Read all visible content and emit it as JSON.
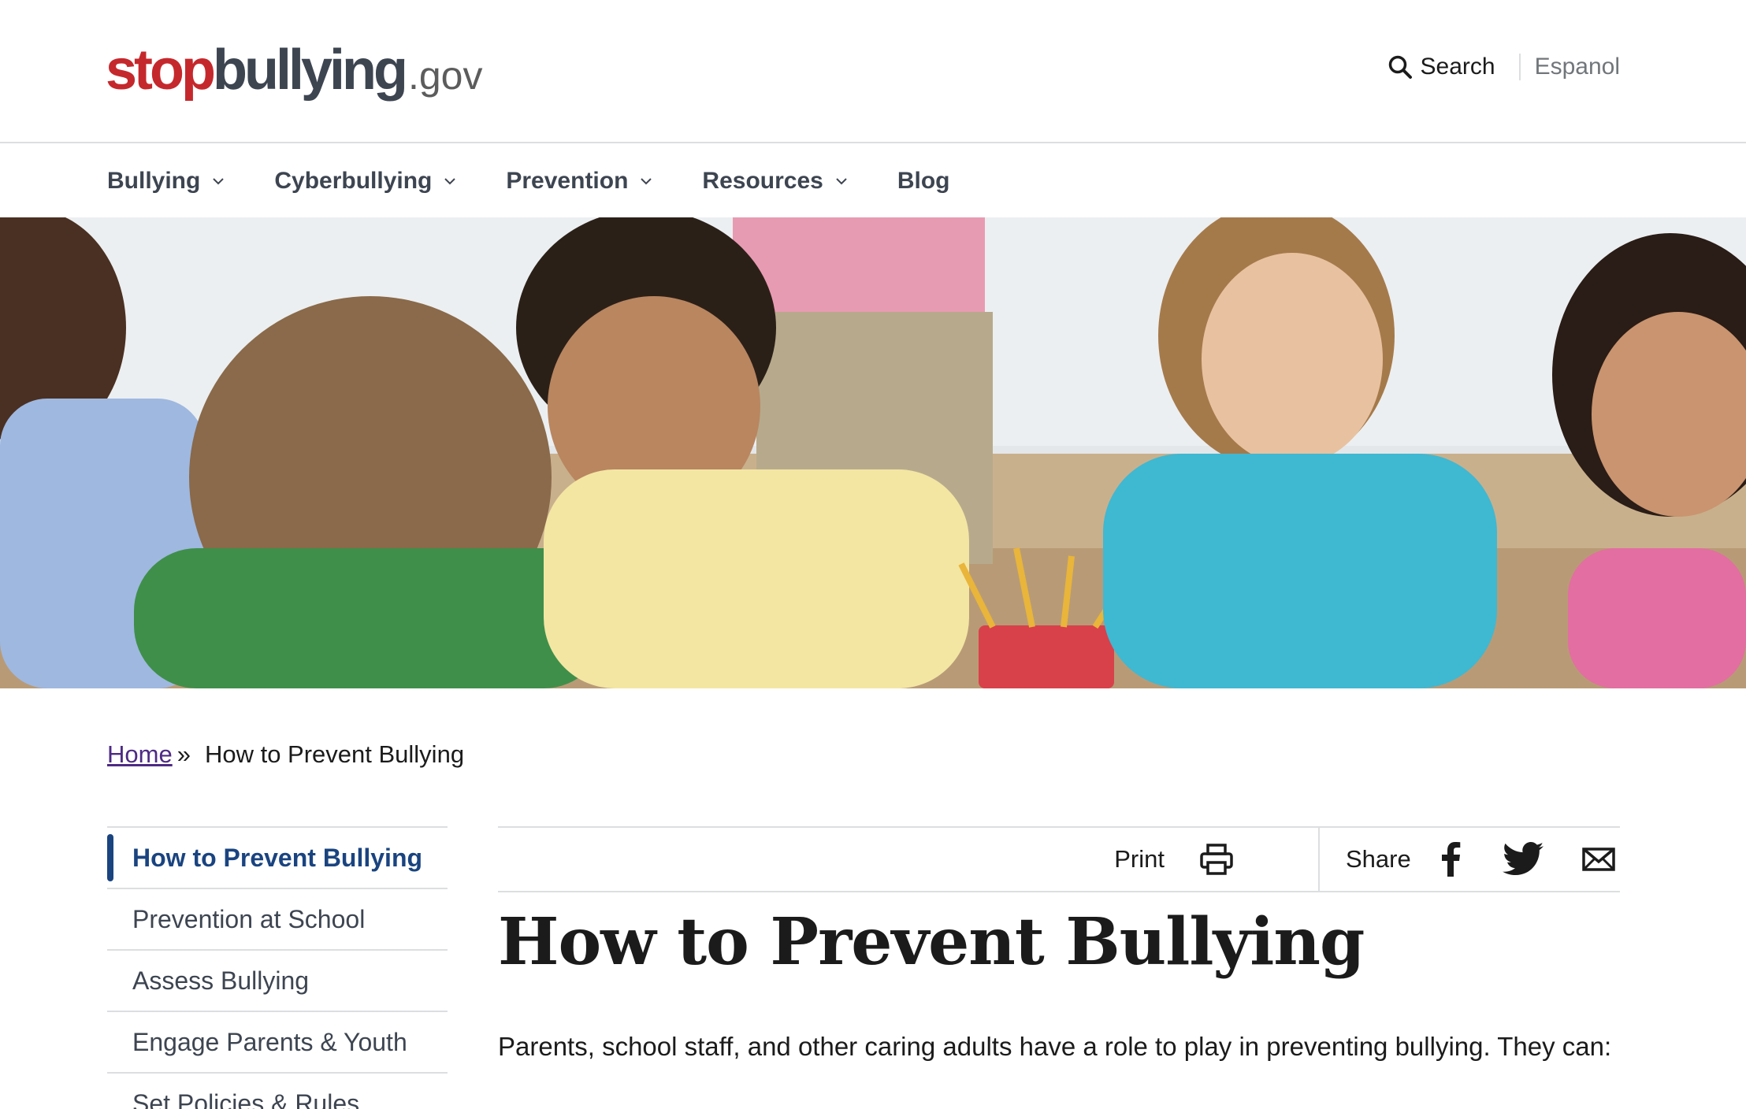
{
  "header": {
    "logo": {
      "stop": "stop",
      "bullying": "bullying",
      "gov": ".gov"
    },
    "search_label": "Search",
    "language_link": "Espanol"
  },
  "nav": {
    "items": [
      {
        "label": "Bullying",
        "has_dropdown": true
      },
      {
        "label": "Cyberbullying",
        "has_dropdown": true
      },
      {
        "label": "Prevention",
        "has_dropdown": true
      },
      {
        "label": "Resources",
        "has_dropdown": true
      },
      {
        "label": "Blog",
        "has_dropdown": false
      }
    ]
  },
  "breadcrumb": {
    "home": "Home",
    "separator": "»",
    "current": "How to Prevent Bullying"
  },
  "sidenav": {
    "items": [
      {
        "label": "How to Prevent Bullying",
        "active": true
      },
      {
        "label": "Prevention at School",
        "active": false
      },
      {
        "label": "Assess Bullying",
        "active": false
      },
      {
        "label": "Engage Parents & Youth",
        "active": false
      },
      {
        "label": "Set Policies & Rules",
        "active": false
      }
    ]
  },
  "toolbar": {
    "print_label": "Print",
    "share_label": "Share",
    "share_icons": [
      "facebook-icon",
      "twitter-icon",
      "email-icon"
    ]
  },
  "main": {
    "title": "How to Prevent Bullying",
    "intro": "Parents, school staff, and other caring adults have a role to play in preventing bullying. They can:"
  },
  "colors": {
    "brand_red": "#c5282c",
    "brand_dark": "#3d4551",
    "active_blue": "#1a4480",
    "link_purple": "#4e2a84",
    "border": "#dcdee0"
  }
}
